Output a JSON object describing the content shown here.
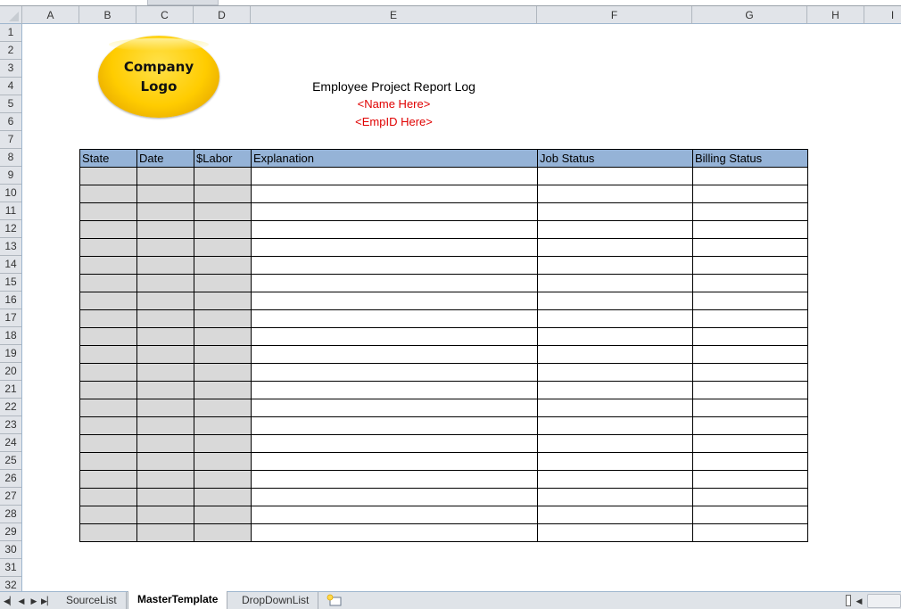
{
  "sheet": {
    "columns": [
      "A",
      "B",
      "C",
      "D",
      "E",
      "F",
      "G",
      "H",
      "I"
    ],
    "rows": [
      "1",
      "2",
      "3",
      "4",
      "5",
      "6",
      "7",
      "8",
      "9",
      "10",
      "11",
      "12",
      "13",
      "14",
      "15",
      "16",
      "17",
      "18",
      "19",
      "20",
      "21",
      "22",
      "23",
      "24",
      "25",
      "26",
      "27",
      "28",
      "29",
      "30",
      "31",
      "32"
    ]
  },
  "logo": {
    "line1": "Company",
    "line2": "Logo",
    "fill_color": "#ffcc00"
  },
  "header": {
    "title": "Employee Project Report Log",
    "name_placeholder": "<Name Here>",
    "empid_placeholder": "<EmpID Here>",
    "placeholder_color": "#e00000"
  },
  "table": {
    "header_color": "#95b3d7",
    "shaded_color": "#d9d9d9",
    "headers": [
      "State",
      "Date",
      "$Labor",
      "Explanation",
      "Job Status",
      "Billing Status"
    ],
    "row_count": 21
  },
  "tabs": {
    "items": [
      {
        "label": "SourceList",
        "active": false
      },
      {
        "label": "MasterTemplate",
        "active": true
      },
      {
        "label": "DropDownList",
        "active": false
      }
    ],
    "nav": [
      "first-sheet",
      "prev-sheet",
      "next-sheet",
      "last-sheet"
    ]
  }
}
